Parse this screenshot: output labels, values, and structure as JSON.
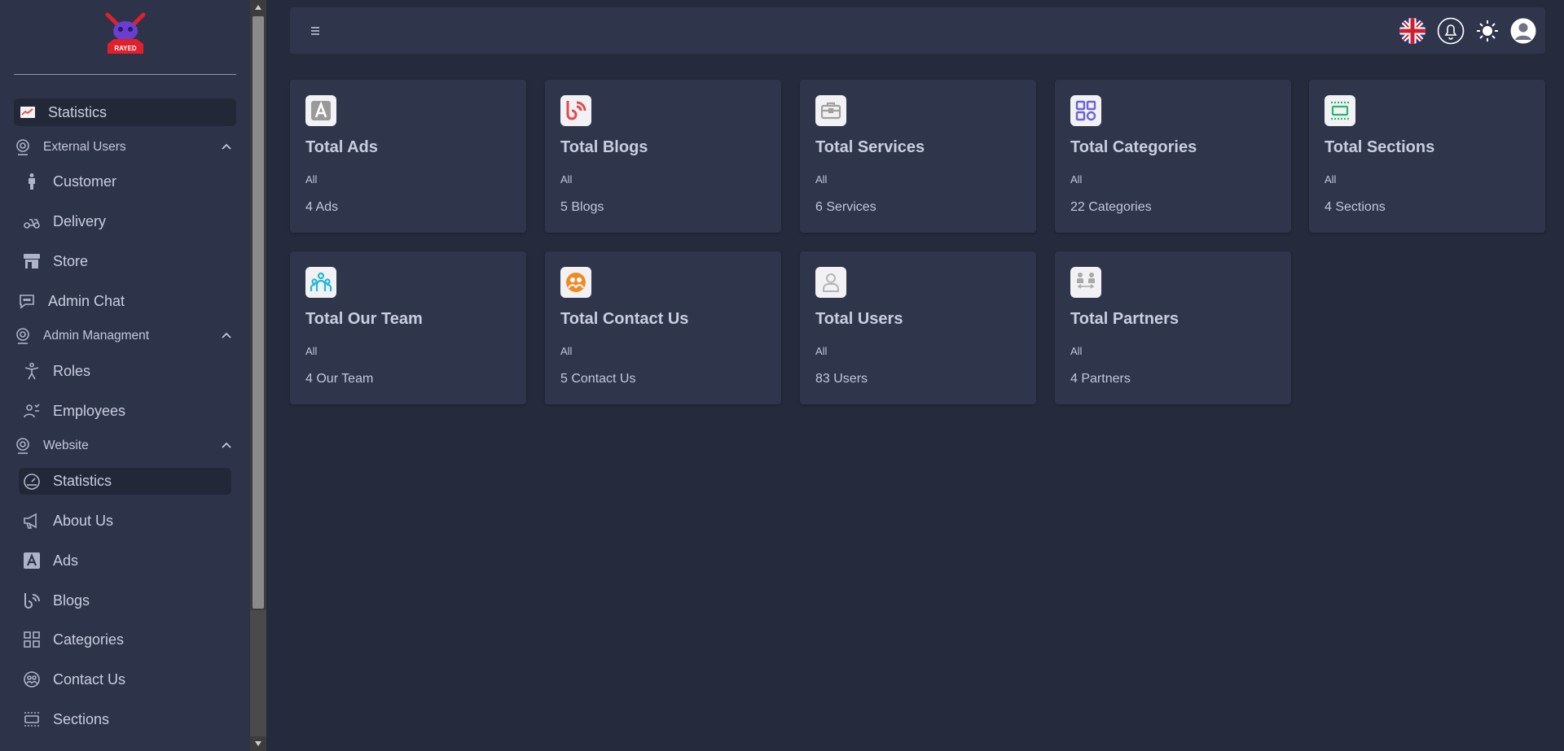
{
  "colors": {
    "background": "#252a3d",
    "sidebar": "#2d3349",
    "card": "#2f354b",
    "text": "#c9cde0"
  },
  "sidebar": {
    "logo_text": "RAYED",
    "top_item": {
      "label": "Statistics",
      "icon": "chart-icon"
    },
    "groups": [
      {
        "label": "External Users",
        "items": [
          {
            "label": "Customer",
            "icon": "person-icon"
          },
          {
            "label": "Delivery",
            "icon": "scooter-icon"
          },
          {
            "label": "Store",
            "icon": "store-icon"
          }
        ]
      },
      {
        "standalone": {
          "label": "Admin Chat",
          "icon": "chat-icon"
        }
      },
      {
        "label": "Admin Managment",
        "items": [
          {
            "label": "Roles",
            "icon": "accessibility-icon"
          },
          {
            "label": "Employees",
            "icon": "employees-icon"
          }
        ]
      },
      {
        "label": "Website",
        "items": [
          {
            "label": "Statistics",
            "icon": "gauge-icon"
          },
          {
            "label": "About Us",
            "icon": "megaphone-icon"
          },
          {
            "label": "Ads",
            "icon": "ads-icon"
          },
          {
            "label": "Blogs",
            "icon": "blog-icon"
          },
          {
            "label": "Categories",
            "icon": "grid-icon"
          },
          {
            "label": "Contact Us",
            "icon": "contact-icon"
          },
          {
            "label": "Sections",
            "icon": "sections-icon"
          }
        ]
      }
    ]
  },
  "topbar": {
    "menu_icon": "hamburger-icon",
    "language": "English",
    "icons": [
      "flag-uk-icon",
      "bell-icon",
      "sun-icon",
      "user-avatar-icon"
    ]
  },
  "cards": [
    {
      "title": "Total Ads",
      "sub": "All",
      "count": "4 Ads",
      "icon": "ads-icon",
      "color": "#9a9a9a"
    },
    {
      "title": "Total Blogs",
      "sub": "All",
      "count": "5 Blogs",
      "icon": "blog-icon",
      "color": "#e5484d"
    },
    {
      "title": "Total Services",
      "sub": "All",
      "count": "6 Services",
      "icon": "toolbox-icon",
      "color": "#a0a0a0"
    },
    {
      "title": "Total Categories",
      "sub": "All",
      "count": "22 Categories",
      "icon": "grid-icon",
      "color": "#6c63d8"
    },
    {
      "title": "Total Sections",
      "sub": "All",
      "count": "4 Sections",
      "icon": "sections-icon",
      "color": "#2bb673"
    },
    {
      "title": "Total Our Team",
      "sub": "All",
      "count": "4 Our Team",
      "icon": "team-icon",
      "color": "#20b7d6"
    },
    {
      "title": "Total Contact Us",
      "sub": "All",
      "count": "5 Contact Us",
      "icon": "contact-icon",
      "color": "#f08a24"
    },
    {
      "title": "Total Users",
      "sub": "All",
      "count": "83 Users",
      "icon": "user-icon",
      "color": "#b5b5b5"
    },
    {
      "title": "Total Partners",
      "sub": "All",
      "count": "4 Partners",
      "icon": "partners-icon",
      "color": "#a8a8a8"
    }
  ]
}
